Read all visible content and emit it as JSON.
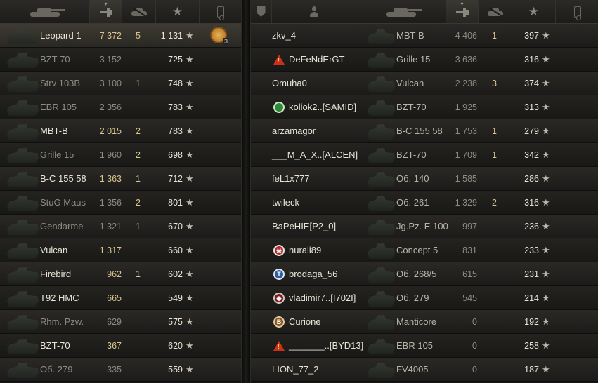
{
  "left_team": {
    "header": {
      "sort_arrow": "▾",
      "star_icon": "★"
    },
    "players": [
      {
        "name": "Leopard 1",
        "damage": "7 372",
        "kills": "5",
        "xp": "1 131",
        "highlight": true,
        "color": "bright",
        "medal": {
          "icon": "ace-medal-icon",
          "count": "3"
        }
      },
      {
        "name": "BZT-70",
        "damage": "3 152",
        "kills": "",
        "xp": "725",
        "color": "dim"
      },
      {
        "name": "Strv 103B",
        "damage": "3 100",
        "kills": "1",
        "xp": "748",
        "color": "dim"
      },
      {
        "name": "EBR 105",
        "damage": "2 356",
        "kills": "",
        "xp": "783",
        "color": "dim"
      },
      {
        "name": "MBT-B",
        "damage": "2 015",
        "kills": "2",
        "xp": "783",
        "color": "bright"
      },
      {
        "name": "Grille 15",
        "damage": "1 960",
        "kills": "2",
        "xp": "698",
        "color": "dim"
      },
      {
        "name": "B-C 155 58",
        "damage": "1 363",
        "kills": "1",
        "xp": "712",
        "color": "bright"
      },
      {
        "name": "StuG Maus",
        "damage": "1 356",
        "kills": "2",
        "xp": "801",
        "color": "dim"
      },
      {
        "name": "Gendarme",
        "damage": "1 321",
        "kills": "1",
        "xp": "670",
        "color": "dim"
      },
      {
        "name": "Vulcan",
        "damage": "1 317",
        "kills": "",
        "xp": "660",
        "color": "bright"
      },
      {
        "name": "Firebird",
        "damage": "962",
        "kills": "1",
        "xp": "602",
        "color": "bright"
      },
      {
        "name": "T92 HMC",
        "damage": "665",
        "kills": "",
        "xp": "549",
        "color": "bright"
      },
      {
        "name": "Rhm. Pzw.",
        "damage": "629",
        "kills": "",
        "xp": "575",
        "color": "dim"
      },
      {
        "name": "BZT-70",
        "damage": "367",
        "kills": "",
        "xp": "620",
        "color": "bright"
      },
      {
        "name": "Об. 279",
        "damage": "335",
        "kills": "",
        "xp": "559",
        "color": "dim"
      }
    ]
  },
  "right_team": {
    "header": {
      "sort_arrow": "▾",
      "star_icon": "★"
    },
    "players": [
      {
        "player": "zkv_4",
        "badge": null,
        "tank": "MBT-B",
        "damage": "4 406",
        "kills": "1",
        "xp": "397"
      },
      {
        "player": "DeFeNdErGT",
        "badge": "warning-clan-icon",
        "tank": "Grille 15",
        "damage": "3 636",
        "kills": "",
        "xp": "316"
      },
      {
        "player": "Omuha0",
        "badge": null,
        "tank": "Vulcan",
        "damage": "2 238",
        "kills": "3",
        "xp": "374"
      },
      {
        "player": "koliok2..[SAMID]",
        "badge": "green-clan-icon",
        "tank": "BZT-70",
        "damage": "1 925",
        "kills": "",
        "xp": "313"
      },
      {
        "player": "arzamagor",
        "badge": null,
        "tank": "B-C 155 58",
        "damage": "1 753",
        "kills": "1",
        "xp": "279"
      },
      {
        "player": "___M_A_X..[ALCEN]",
        "badge": null,
        "tank": "BZT-70",
        "damage": "1 709",
        "kills": "1",
        "xp": "342"
      },
      {
        "player": "feL1x777",
        "badge": null,
        "tank": "Об. 140",
        "damage": "1 585",
        "kills": "",
        "xp": "286"
      },
      {
        "player": "twileck",
        "badge": null,
        "tank": "Об. 261",
        "damage": "1 329",
        "kills": "2",
        "xp": "316"
      },
      {
        "player": "BaPeHIE[P2_0]",
        "badge": null,
        "tank": "Jg.Pz. E 100",
        "damage": "997",
        "kills": "",
        "xp": "236"
      },
      {
        "player": "nurali89",
        "badge": "skull-clan-icon",
        "tank": "Concept 5",
        "damage": "831",
        "kills": "",
        "xp": "233"
      },
      {
        "player": "brodaga_56",
        "badge": "blue-clan-icon",
        "tank": "Об. 268/5",
        "damage": "615",
        "kills": "",
        "xp": "231"
      },
      {
        "player": "vladimir7..[I702I]",
        "badge": "red-clan-icon",
        "tank": "Об. 279",
        "damage": "545",
        "kills": "",
        "xp": "214"
      },
      {
        "player": "Curione",
        "badge": "bronze-clan-icon",
        "tank": "Manticore",
        "damage": "0",
        "kills": "",
        "xp": "192"
      },
      {
        "player": "_______..[BYD13]",
        "badge": "warning-clan-icon",
        "tank": "EBR 105",
        "damage": "0",
        "kills": "",
        "xp": "258"
      },
      {
        "player": "LION_77_2",
        "badge": null,
        "tank": "FV4005",
        "damage": "0",
        "kills": "",
        "xp": "187"
      }
    ]
  },
  "colors": {
    "gold": "#d9c38e",
    "bright": "#e8e4d6",
    "dim": "#8e8b82",
    "clan_warning": "#c9301d"
  }
}
